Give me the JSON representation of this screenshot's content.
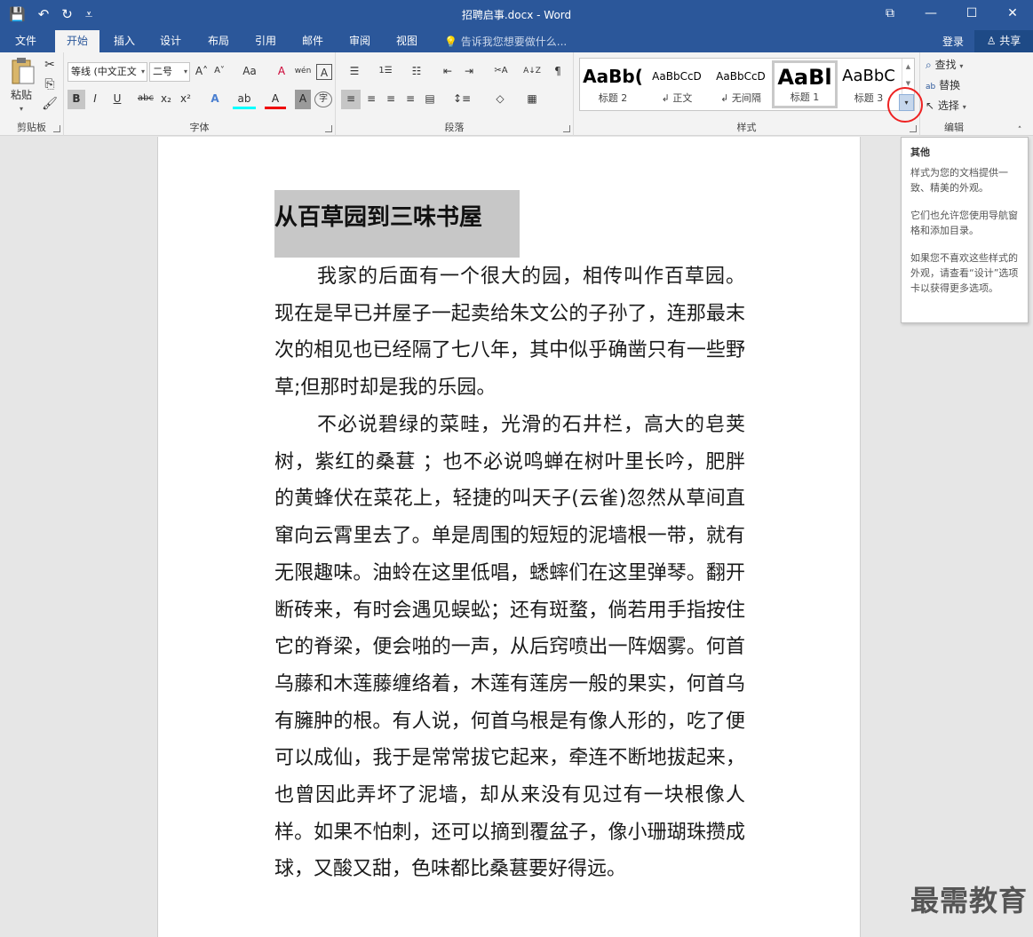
{
  "window": {
    "title": "招聘启事.docx - Word",
    "qat": {
      "save_icon": "💾",
      "undo_icon": "↶",
      "redo_icon": "↻",
      "customize_icon": "⩡"
    },
    "controls": {
      "ribbon_display": "⧉",
      "minimize": "—",
      "maximize": "☐",
      "close": "✕"
    }
  },
  "tabs": [
    {
      "label": "文件"
    },
    {
      "label": "开始"
    },
    {
      "label": "插入"
    },
    {
      "label": "设计"
    },
    {
      "label": "布局"
    },
    {
      "label": "引用"
    },
    {
      "label": "邮件"
    },
    {
      "label": "审阅"
    },
    {
      "label": "视图"
    }
  ],
  "tell_me": "💡 告诉我您想要做什么...",
  "login": "登录",
  "share": "♙ 共享",
  "ribbon": {
    "clipboard": {
      "label": "剪贴板",
      "paste": "粘贴",
      "paste_drop": "▾"
    },
    "font": {
      "label": "字体",
      "font_name": "等线 (中文正文",
      "font_size": "二号",
      "grow": "A˄",
      "shrink": "A˅",
      "change_case": "Aa",
      "clear_format": "A",
      "pinyin": "wén",
      "char_border": "A",
      "bold": "B",
      "italic": "I",
      "underline": "U",
      "strike": "abc",
      "subscript": "x₂",
      "superscript": "x²",
      "text_effect": "A",
      "highlight": "ab",
      "font_color": "A",
      "char_shading": "A",
      "enclose": "字"
    },
    "paragraph": {
      "label": "段落",
      "bullets": "☰",
      "numbering": "1☰",
      "multilevel": "☷",
      "dec_indent": "⇤",
      "inc_indent": "⇥",
      "chinese_layout": "✂A",
      "sort": "A↓Z",
      "show_marks": "¶",
      "align_left": "≡",
      "align_center": "≡",
      "align_right": "≡",
      "justify": "≡",
      "distributed": "▤",
      "line_spacing": "↕≡",
      "shading": "◇",
      "borders": "▦"
    },
    "styles": {
      "label": "样式",
      "items": [
        {
          "preview": "AaBb(",
          "name": "标题 2"
        },
        {
          "preview": "AaBbCcD",
          "name": "↲ 正文"
        },
        {
          "preview": "AaBbCcD",
          "name": "↲ 无间隔"
        },
        {
          "preview": "AaBl",
          "name": "标题 1"
        },
        {
          "preview": "AaBbC",
          "name": "标题 3"
        }
      ],
      "more": "▾"
    },
    "editing": {
      "label": "编辑",
      "find": "查找",
      "replace": "替换",
      "select": "选择"
    }
  },
  "tooltip": {
    "title": "其他",
    "p1": "样式为您的文档提供一致、精美的外观。",
    "p2": "它们也允许您使用导航窗格和添加目录。",
    "p3": "如果您不喜欢这些样式的外观，请查看“设计”选项卡以获得更多选项。"
  },
  "document": {
    "heading": "从百草园到三味书屋",
    "para1": "我家的后面有一个很大的园，相传叫作百草园。现在是早已并屋子一起卖给朱文公的子孙了，连那最末次的相见也已经隔了七八年，其中似乎确凿只有一些野草;但那时却是我的乐园。",
    "para2": "不必说碧绿的菜畦，光滑的石井栏，高大的皂荚树，紫红的桑葚 ；也不必说鸣蝉在树叶里长吟，肥胖的黄蜂伏在菜花上，轻捷的叫天子(云雀)忽然从草间直窜向云霄里去了。单是周围的短短的泥墙根一带，就有无限趣味。油蛉在这里低唱，蟋蟀们在这里弹琴。翻开断砖来，有时会遇见蜈蚣；还有斑蝥，倘若用手指按住它的脊梁，便会啪的一声，从后窍喷出一阵烟雾。何首乌藤和木莲藤缠络着，木莲有莲房一般的果实，何首乌有臃肿的根。有人说，何首乌根是有像人形的，吃了便可以成仙，我于是常常拔它起来，牵连不断地拔起来，也曾因此弄坏了泥墙，却从来没有见过有一块根像人样。如果不怕刺，还可以摘到覆盆子，像小珊瑚珠攒成球，又酸又甜，色味都比桑葚要好得远。"
  },
  "watermark": "最需教育"
}
